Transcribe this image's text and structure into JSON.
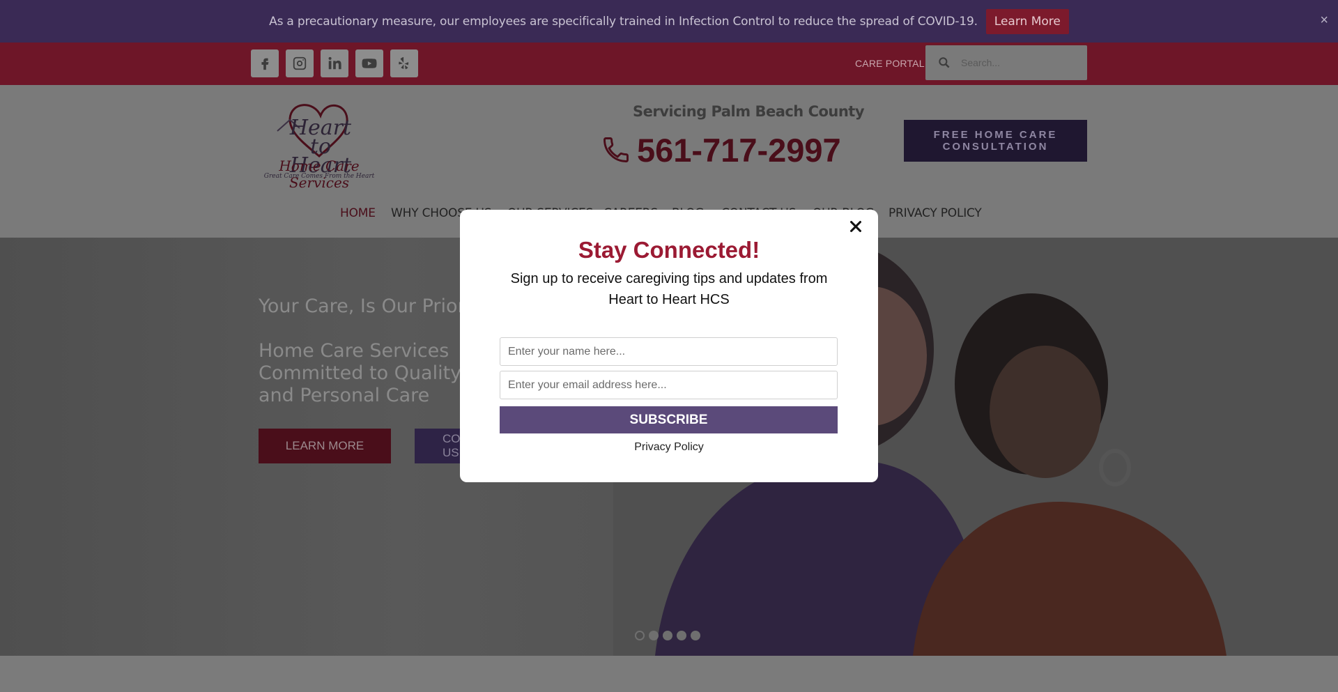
{
  "notice": {
    "text": "As a precautionary measure, our employees are specifically trained in Infection Control to reduce the spread of COVID-19.",
    "button": "Learn More",
    "close": "×"
  },
  "topbar": {
    "social": [
      "facebook-icon",
      "instagram-icon",
      "linkedin-icon",
      "youtube-icon",
      "yelp-icon"
    ],
    "care_portal": "CARE PORTAL",
    "search_placeholder": "Search..."
  },
  "header": {
    "logo_line1": "Heart to",
    "logo_line2": "Heart",
    "logo_line3": "Home Care Services",
    "logo_tagline": "Great Care Comes From the Heart",
    "servicing": "Servicing Palm Beach County",
    "phone": "561-717-2997",
    "consult_button": "FREE HOME CARE CONSULTATION"
  },
  "nav": {
    "items": [
      "HOME",
      "WHY CHOOSE US",
      "OUR SERVICES",
      "CAREERS",
      "BLOG",
      "CONTACT US",
      "OUR BLOG",
      "PRIVACY POLICY"
    ]
  },
  "hero": {
    "headline": "Your Care, Is Our Priority",
    "subheadline": "Home Care Services Committed to Quality and Personal Care",
    "button1": "LEARN MORE",
    "button2": "CONTACT US",
    "slide_count": 5,
    "active_slide": 1
  },
  "modal": {
    "close": "×",
    "title": "Stay Connected!",
    "subtitle": "Sign up to receive caregiving tips and updates from Heart to Heart HCS",
    "name_placeholder": "Enter your name here...",
    "email_placeholder": "Enter your email address here...",
    "subscribe": "SUBSCRIBE",
    "privacy": "Privacy Policy"
  },
  "colors": {
    "accent_red": "#9b1a33",
    "accent_purple": "#5b4a7a",
    "notice_bg": "#3a2a55",
    "social_bg": "#6e1628"
  }
}
